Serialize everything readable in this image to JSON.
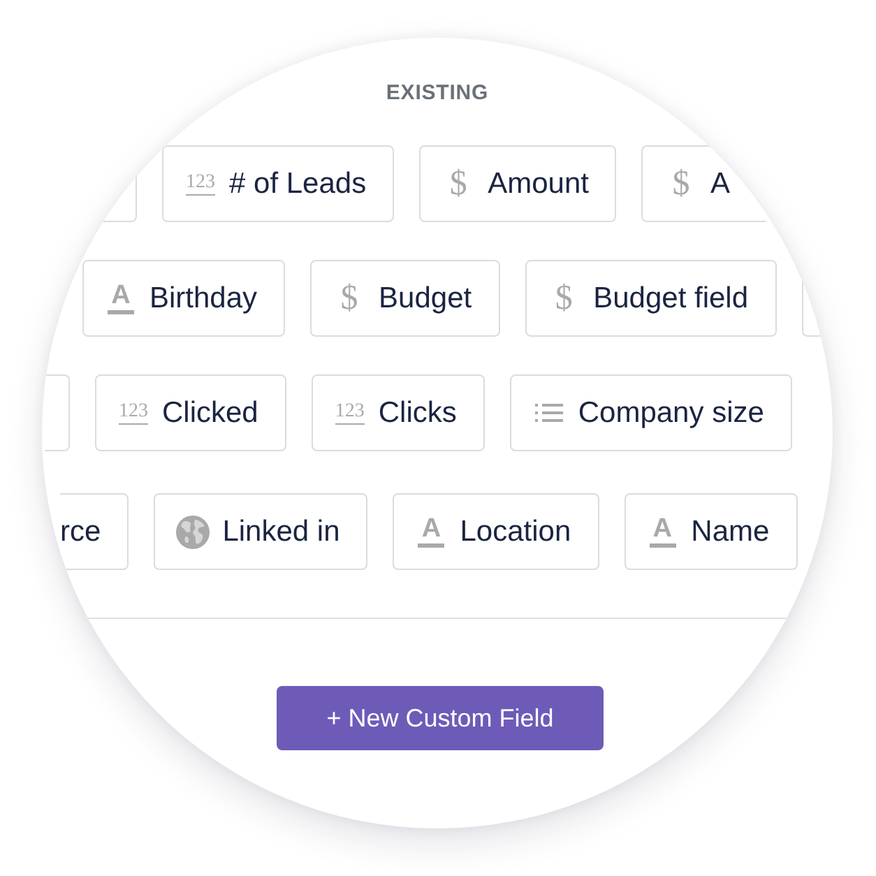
{
  "section": {
    "title": "EXISTING"
  },
  "field_rows": [
    {
      "fields": [
        {
          "kind": "stub"
        },
        {
          "kind": "number",
          "glyph": "123",
          "label": "# of Leads"
        },
        {
          "kind": "currency",
          "glyph": "$",
          "label": "Amount"
        },
        {
          "kind": "currency",
          "glyph": "$",
          "label": "A"
        }
      ]
    },
    {
      "fields": [
        {
          "kind": "text",
          "glyph": "A",
          "label": "Birthday"
        },
        {
          "kind": "currency",
          "glyph": "$",
          "label": "Budget"
        },
        {
          "kind": "currency",
          "glyph": "$",
          "label": "Budget field"
        },
        {
          "kind": "stub"
        }
      ]
    },
    {
      "fields": [
        {
          "kind": "stub"
        },
        {
          "kind": "number",
          "glyph": "123",
          "label": "Clicked"
        },
        {
          "kind": "number",
          "glyph": "123",
          "label": "Clicks"
        },
        {
          "kind": "list",
          "label": "Company size"
        }
      ]
    },
    {
      "fields": [
        {
          "kind": "plain",
          "label": "rce"
        },
        {
          "kind": "globe",
          "label": "Linked in"
        },
        {
          "kind": "text",
          "glyph": "A",
          "label": "Location"
        },
        {
          "kind": "text",
          "glyph": "A",
          "label": "Name"
        }
      ]
    }
  ],
  "button": {
    "label": "+ New Custom Field"
  }
}
